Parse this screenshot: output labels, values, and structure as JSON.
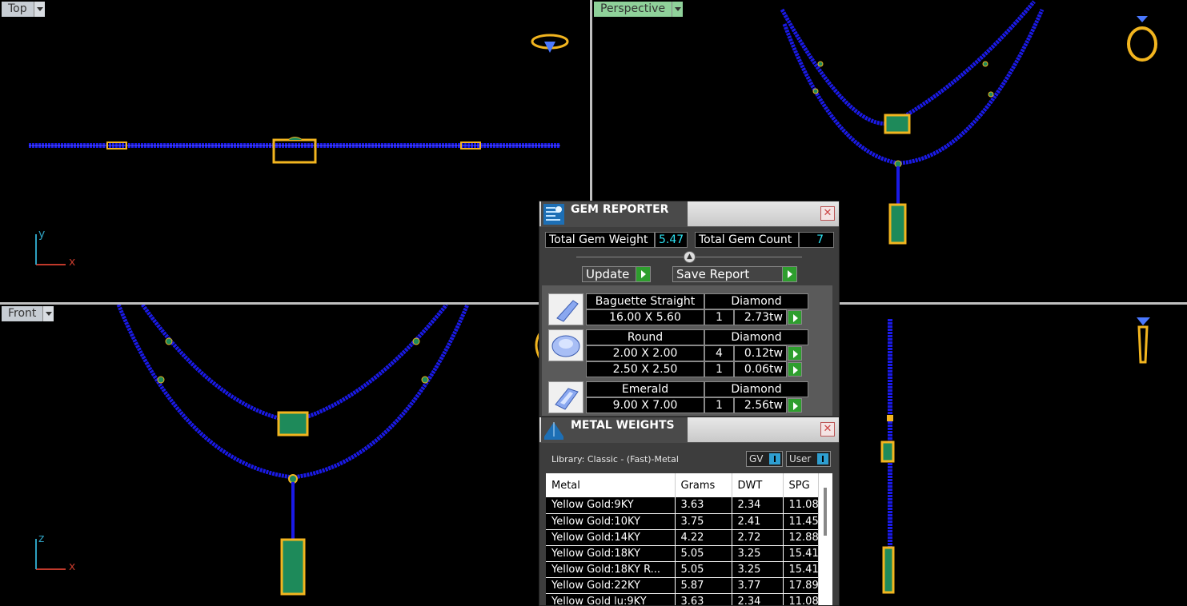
{
  "viewports": {
    "top": {
      "label": "Top",
      "axis1": "x",
      "axis2": "y"
    },
    "perspective": {
      "label": "Perspective"
    },
    "front": {
      "label": "Front",
      "axis1": "x",
      "axis2": "z"
    },
    "right": {
      "label": ""
    }
  },
  "gem_reporter": {
    "title": "GEM REPORTER",
    "total_weight_label": "Total Gem Weight",
    "total_weight_value": "5.47",
    "total_count_label": "Total Gem Count",
    "total_count_value": "7",
    "update_label": "Update",
    "save_label": "Save Report",
    "gems": [
      {
        "shape": "Baguette Straight",
        "type": "Diamond",
        "sizes": [
          {
            "size": "16.00 X 5.60",
            "count": "1",
            "weight": "2.73tw"
          }
        ]
      },
      {
        "shape": "Round",
        "type": "Diamond",
        "sizes": [
          {
            "size": "2.00 X 2.00",
            "count": "4",
            "weight": "0.12tw"
          },
          {
            "size": "2.50 X 2.50",
            "count": "1",
            "weight": "0.06tw"
          }
        ]
      },
      {
        "shape": "Emerald",
        "type": "Diamond",
        "sizes": [
          {
            "size": "9.00 X 7.00",
            "count": "1",
            "weight": "2.56tw"
          }
        ]
      }
    ]
  },
  "metal_weights": {
    "title": "METAL WEIGHTS",
    "library": "Library: Classic - (Fast)-Metal",
    "toggle_gv": "GV",
    "toggle_user": "User",
    "columns": [
      "Metal",
      "Grams",
      "DWT",
      "SPG"
    ],
    "rows": [
      [
        "Yellow Gold:9KY",
        "3.63",
        "2.34",
        "11.08"
      ],
      [
        "Yellow Gold:10KY",
        "3.75",
        "2.41",
        "11.45"
      ],
      [
        "Yellow Gold:14KY",
        "4.22",
        "2.72",
        "12.88"
      ],
      [
        "Yellow Gold:18KY",
        "5.05",
        "3.25",
        "15.41"
      ],
      [
        "Yellow Gold:18KY R...",
        "5.05",
        "3.25",
        "15.41"
      ],
      [
        "Yellow Gold:22KY",
        "5.87",
        "3.77",
        "17.89"
      ],
      [
        "Yellow Gold lu:9KY",
        "3.63",
        "2.34",
        "11.08"
      ]
    ]
  },
  "colors": {
    "chain": "#1a1ae6",
    "gold": "#f2b51f",
    "gem": "#1e8a5a",
    "active_label": "#8fd19a"
  }
}
